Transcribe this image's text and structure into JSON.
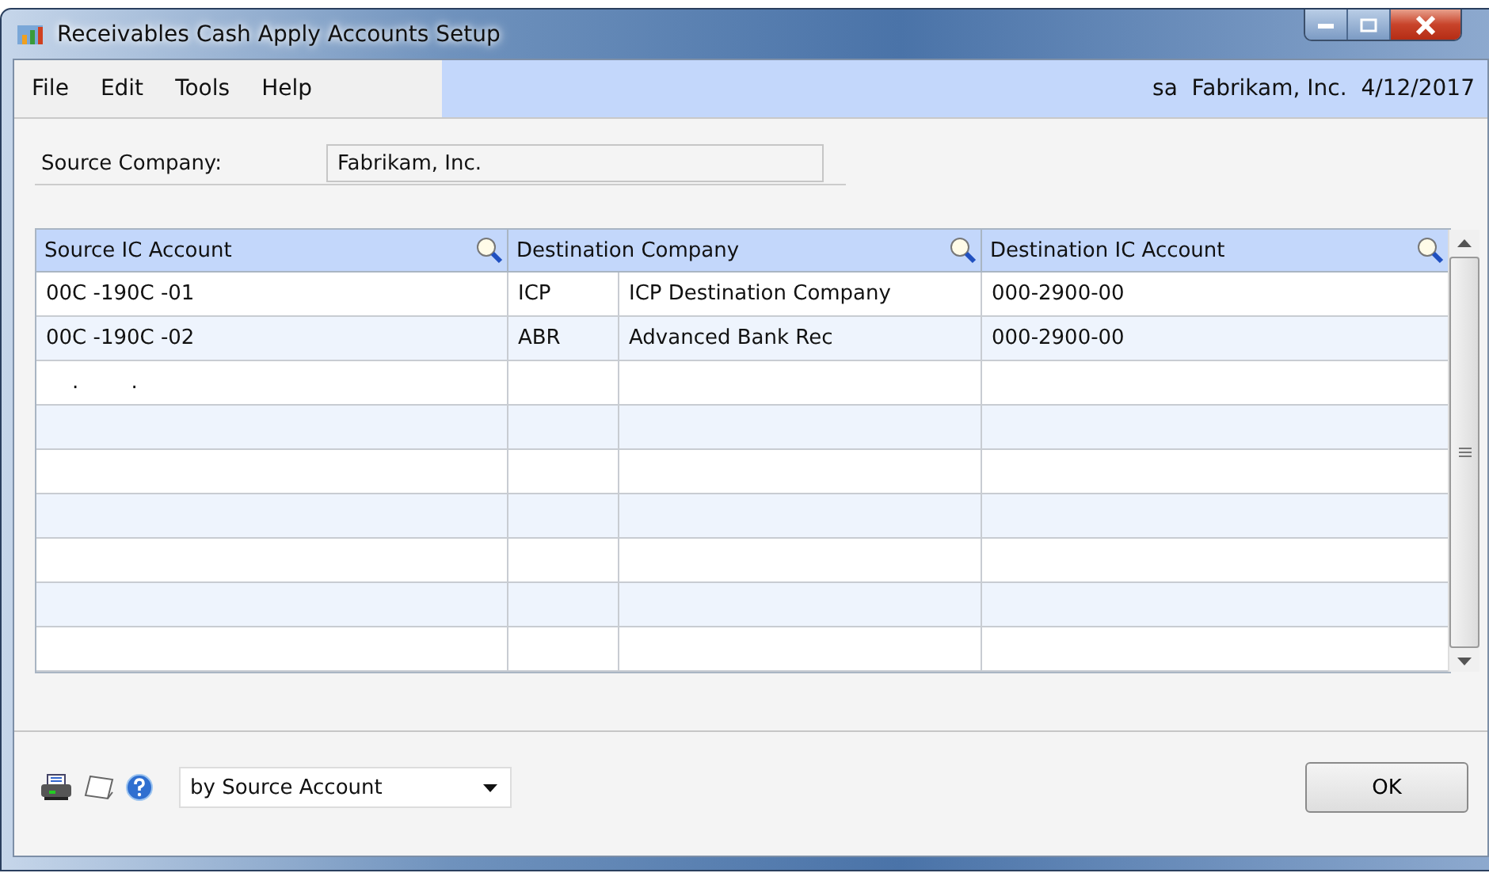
{
  "window": {
    "title": "Receivables Cash Apply Accounts Setup"
  },
  "menu": [
    "File",
    "Edit",
    "Tools",
    "Help"
  ],
  "user_info": "sa  Fabrikam, Inc.  4/12/2017",
  "source_company": {
    "label": "Source Company:",
    "value": "Fabrikam, Inc."
  },
  "table": {
    "columns": [
      {
        "label": "Source IC Account",
        "lookup": true
      },
      {
        "label": "Destination Company",
        "lookup": true
      },
      {
        "label": "Destination IC Account",
        "lookup": true
      }
    ],
    "rows": [
      {
        "source_account": "00C -190C -01",
        "dest_code": "ICP",
        "dest_company": "ICP Destination Company",
        "dest_account": "000-2900-00"
      },
      {
        "source_account": "00C -190C -02",
        "dest_code": "ABR",
        "dest_company": "Advanced Bank Rec",
        "dest_account": "000-2900-00"
      },
      {
        "source_account": "    .        ."
      }
    ]
  },
  "sort": {
    "value": "by Source Account"
  },
  "buttons": [
    "OK"
  ]
}
